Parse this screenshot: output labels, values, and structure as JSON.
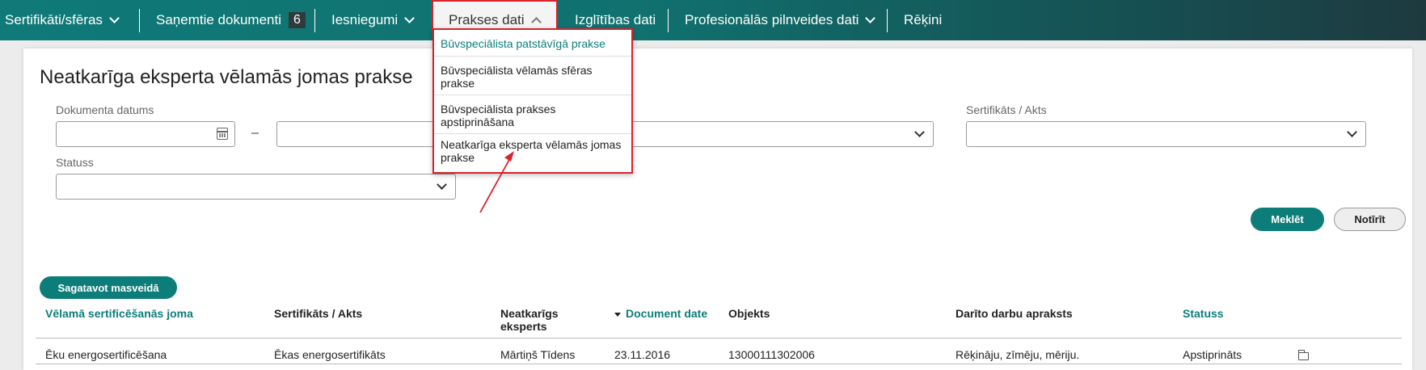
{
  "nav": {
    "items": [
      {
        "label": "Sertifikāti/sfēras",
        "has_chevron": true
      },
      {
        "label": "Saņemtie dokumenti",
        "badge": "6"
      },
      {
        "label": "Iesniegumi",
        "has_chevron": true
      },
      {
        "label": "Prakses dati",
        "has_chevron": true,
        "active": true
      },
      {
        "label": "Izglītības dati"
      },
      {
        "label": "Profesionālās pilnveides dati",
        "has_chevron": true
      },
      {
        "label": "Rēķini"
      }
    ]
  },
  "dropdown": {
    "items": [
      {
        "label": "Būvspeciālista patstāvīgā prakse",
        "active": true
      },
      {
        "label": "Būvspeciālista vēlamās sfēras prakse"
      },
      {
        "label": "Būvspeciālista prakses apstiprināšana"
      },
      {
        "label": "Neatkarīga eksperta vēlamās jomas prakse"
      }
    ]
  },
  "page": {
    "title": "Neatkarīga eksperta vēlamās jomas prakse"
  },
  "filters": {
    "document_date_label": "Dokumenta datums",
    "date_from_value": "",
    "date_to_value": "",
    "date_separator": "–",
    "certificate_label": "Sertifikāts / Akts",
    "certificate_value": "",
    "status_label": "Statuss",
    "status_value": "",
    "search_button": "Meklēt",
    "clear_button": "Notīrīt"
  },
  "actions": {
    "bulk_prepare": "Sagatavot masveidā"
  },
  "table": {
    "headers": {
      "field": "Vēlamā sertificēšanās joma",
      "certificate": "Sertifikāts / Akts",
      "expert": "Neatkarīgs eksperts",
      "date": "Document date",
      "object": "Objekts",
      "description": "Darīto darbu apraksts",
      "status": "Statuss"
    },
    "rows": [
      {
        "field": "Ēku energosertificēšana",
        "certificate": "Ēkas energosertifikāts",
        "expert": "Mārtiņš Tīdens",
        "date": "23.11.2016",
        "object": "13000111302006",
        "description": "Rēķināju, zīmēju, mēriju.",
        "status": "Apstiprināts",
        "action_icon": "folder-open-icon"
      }
    ]
  },
  "colors": {
    "accent": "#0d7d7a",
    "highlight": "#d8232a"
  }
}
